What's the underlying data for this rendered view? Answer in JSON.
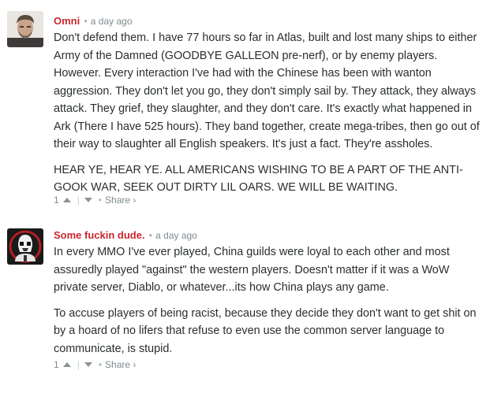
{
  "comments": [
    {
      "author": "Omni",
      "separator": "•",
      "timestamp": "a day ago",
      "paragraphs": [
        "Don't defend them. I have 77 hours so far in Atlas, built and lost many ships to either Army of the Damned (GOODBYE GALLEON pre-nerf), or by enemy players. However. Every interaction I've had with the Chinese has been with wanton aggression. They don't let you go, they don't simply sail by. They attack, they always attack. They grief, they slaughter, and they don't care. It's exactly what happened in Ark (There I have 525 hours). They band together, create mega-tribes, then go out of their way to slaughter all English speakers. It's just a fact. They're assholes.",
        "HEAR YE, HEAR YE. ALL AMERICANS WISHING TO BE A PART OF THE ANTI-GOOK WAR, SEEK OUT DIRTY LIL OARS. WE WILL BE WAITING."
      ],
      "votes": "1",
      "divider": "|",
      "bullet": "•",
      "share": "Share ›",
      "author_color": "#c8272d"
    },
    {
      "author": "Some fuckin dude.",
      "separator": "•",
      "timestamp": "a day ago",
      "paragraphs": [
        "In every MMO I've ever played, China guilds were loyal to each other and most assuredly played \"against\" the western players. Doesn't matter if it was a WoW private server, Diablo, or whatever...its how China plays any game.",
        "To accuse players of being racist, because they decide they don't want to get shit on by a hoard of no lifers that refuse to even use the common server language to communicate, is stupid."
      ],
      "votes": "1",
      "divider": "|",
      "bullet": "•",
      "share": "Share ›",
      "author_color": "#c8272d"
    }
  ],
  "icons": {
    "upvote": "upvote-icon",
    "downvote": "downvote-icon"
  }
}
